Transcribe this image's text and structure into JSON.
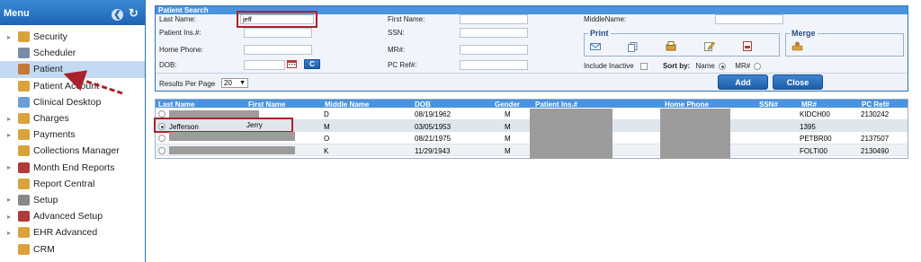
{
  "sidebar": {
    "title": "Menu",
    "items": [
      {
        "label": "Security",
        "has_caret": true,
        "icon": "lock-icon",
        "color": "#d9a23c"
      },
      {
        "label": "Scheduler",
        "has_caret": false,
        "icon": "clock-icon",
        "color": "#7a8da6"
      },
      {
        "label": "Patient",
        "has_caret": false,
        "icon": "person-icon",
        "color": "#c27a3a",
        "selected": true
      },
      {
        "label": "Patient Account",
        "has_caret": false,
        "icon": "account-icon",
        "color": "#d9a23c"
      },
      {
        "label": "Clinical Desktop",
        "has_caret": false,
        "icon": "desktop-icon",
        "color": "#6aa0d6"
      },
      {
        "label": "Charges",
        "has_caret": true,
        "icon": "charges-icon",
        "color": "#d9a23c"
      },
      {
        "label": "Payments",
        "has_caret": true,
        "icon": "payments-icon",
        "color": "#d9a23c"
      },
      {
        "label": "Collections Manager",
        "has_caret": false,
        "icon": "collections-icon",
        "color": "#d9a23c"
      },
      {
        "label": "Month End Reports",
        "has_caret": true,
        "icon": "bar-chart-icon",
        "color": "#b33a3a"
      },
      {
        "label": "Report Central",
        "has_caret": false,
        "icon": "report-icon",
        "color": "#d9a23c"
      },
      {
        "label": "Setup",
        "has_caret": true,
        "icon": "tools-icon",
        "color": "#888888"
      },
      {
        "label": "Advanced Setup",
        "has_caret": true,
        "icon": "wrench-icon",
        "color": "#b33a3a"
      },
      {
        "label": "EHR Advanced",
        "has_caret": true,
        "icon": "ehr-icon",
        "color": "#d9a23c"
      },
      {
        "label": "CRM",
        "has_caret": false,
        "icon": "crm-icon",
        "color": "#d9a23c"
      }
    ]
  },
  "search": {
    "title": "Patient Search",
    "last_name_label": "Last Name:",
    "last_name_value": "jeff",
    "first_name_label": "First Name:",
    "first_name_value": "",
    "middle_name_label": "MiddleName:",
    "middle_name_value": "",
    "patient_ins_label": "Patient Ins.#:",
    "ssn_label": "SSN:",
    "home_phone_label": "Home Phone:",
    "mr_label": "MR#:",
    "dob_label": "DOB:",
    "dob_button": "C",
    "pc_ref_label": "PC Ref#:",
    "print_title": "Print",
    "merge_title": "Merge",
    "include_inactive_label": "Include Inactive",
    "sort_by_label": "Sort by:",
    "sort_name_label": "Name",
    "sort_mr_label": "MR#",
    "results_per_page_label": "Results Per Page",
    "results_per_page_value": "20",
    "add_button": "Add",
    "close_button": "Close"
  },
  "results": {
    "columns": [
      "Last Name",
      "First Name",
      "Middle Name",
      "DOB",
      "Gender",
      "Patient Ins.#",
      "Home Phone",
      "SSN#",
      "MR#",
      "PC Ref#"
    ],
    "rows": [
      {
        "last": "",
        "first": "",
        "middle": "D",
        "dob": "08/19/1962",
        "gender": "M",
        "mr": "KIDCH00",
        "pcref": "2130242"
      },
      {
        "last": "Jefferson",
        "first": "Jerry",
        "middle": "M",
        "dob": "03/05/1953",
        "gender": "M",
        "mr": "1395",
        "pcref": ""
      },
      {
        "last": "",
        "first": "",
        "middle": "O",
        "dob": "08/21/1975",
        "gender": "M",
        "mr": "PETBR00",
        "pcref": "2137507"
      },
      {
        "last": "",
        "first": "",
        "middle": "K",
        "dob": "11/29/1943",
        "gender": "M",
        "mr": "FOLTI00",
        "pcref": "2130490"
      }
    ]
  },
  "colors": {
    "accent": "#1e64b4",
    "highlight": "#a8232b",
    "selected_menu": "#c4daf2"
  }
}
